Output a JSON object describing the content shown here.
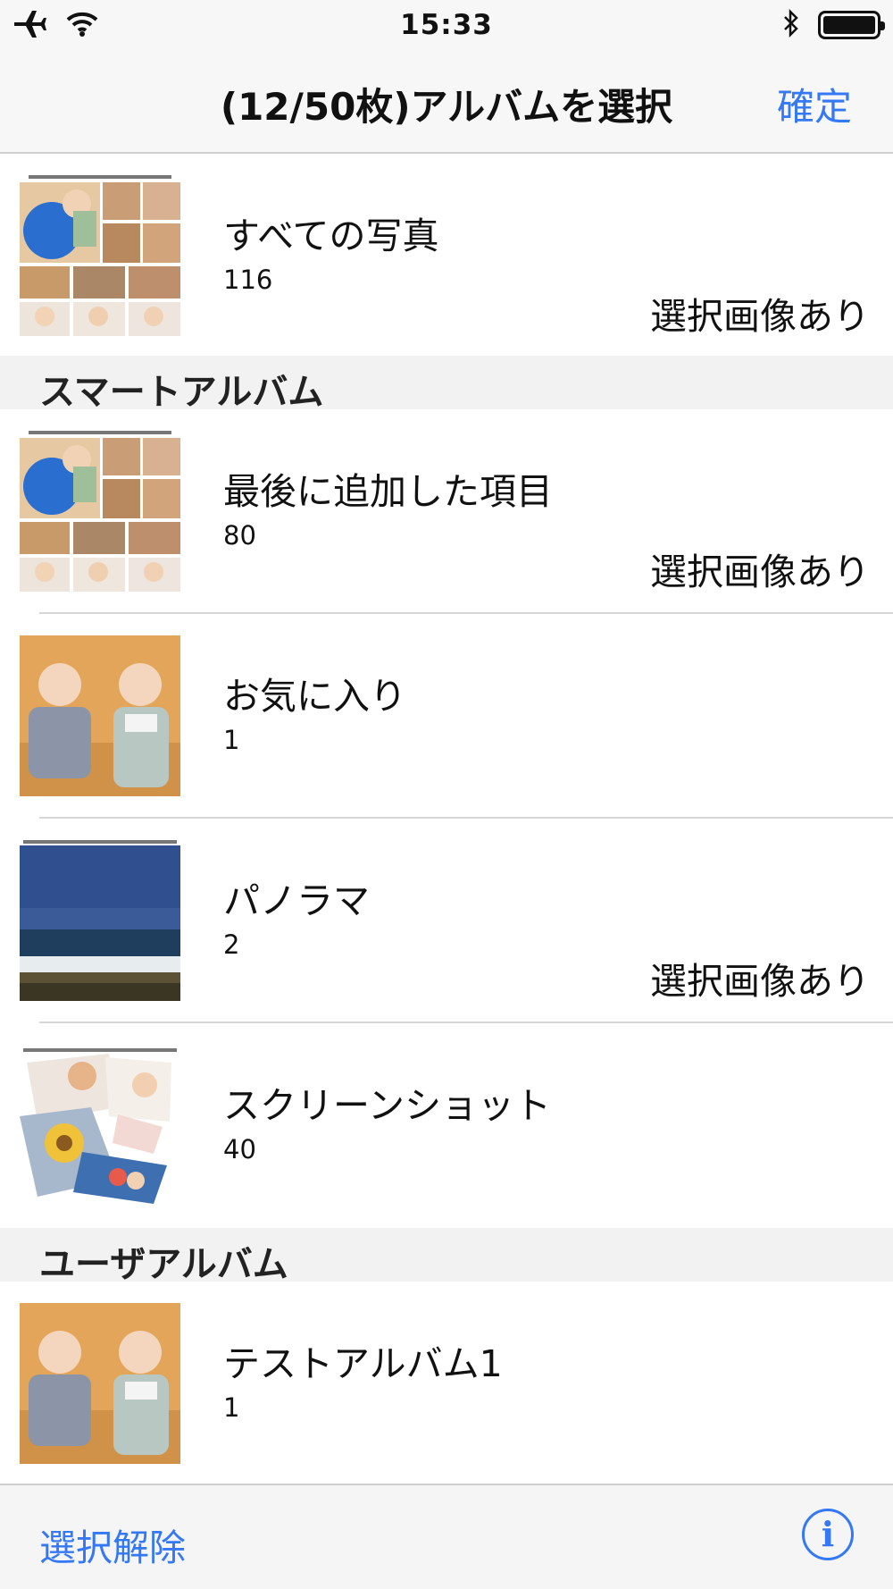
{
  "status_bar": {
    "time": "15:33",
    "icons": [
      "airplane-icon",
      "wifi-icon",
      "bluetooth-icon",
      "battery-icon"
    ]
  },
  "nav": {
    "title": "(12/50枚)アルバムを選択",
    "confirm_label": "確定"
  },
  "albums": {
    "all": {
      "name": "すべての写真",
      "count": "116",
      "badge": "選択画像あり"
    },
    "smart_header": "スマートアルバム",
    "smart": [
      {
        "name": "最後に追加した項目",
        "count": "80",
        "badge": "選択画像あり"
      },
      {
        "name": "お気に入り",
        "count": "1",
        "badge": ""
      },
      {
        "name": "パノラマ",
        "count": "2",
        "badge": "選択画像あり"
      },
      {
        "name": "スクリーンショット",
        "count": "40",
        "badge": ""
      }
    ],
    "user_header": "ユーザアルバム",
    "user": [
      {
        "name": "テストアルバム1",
        "count": "1",
        "badge": ""
      }
    ]
  },
  "toolbar": {
    "deselect_label": "選択解除",
    "info_label": "i"
  },
  "colors": {
    "accent": "#3478f6",
    "separator": "#d6d6d6",
    "section_bg": "#f2f2f2"
  }
}
